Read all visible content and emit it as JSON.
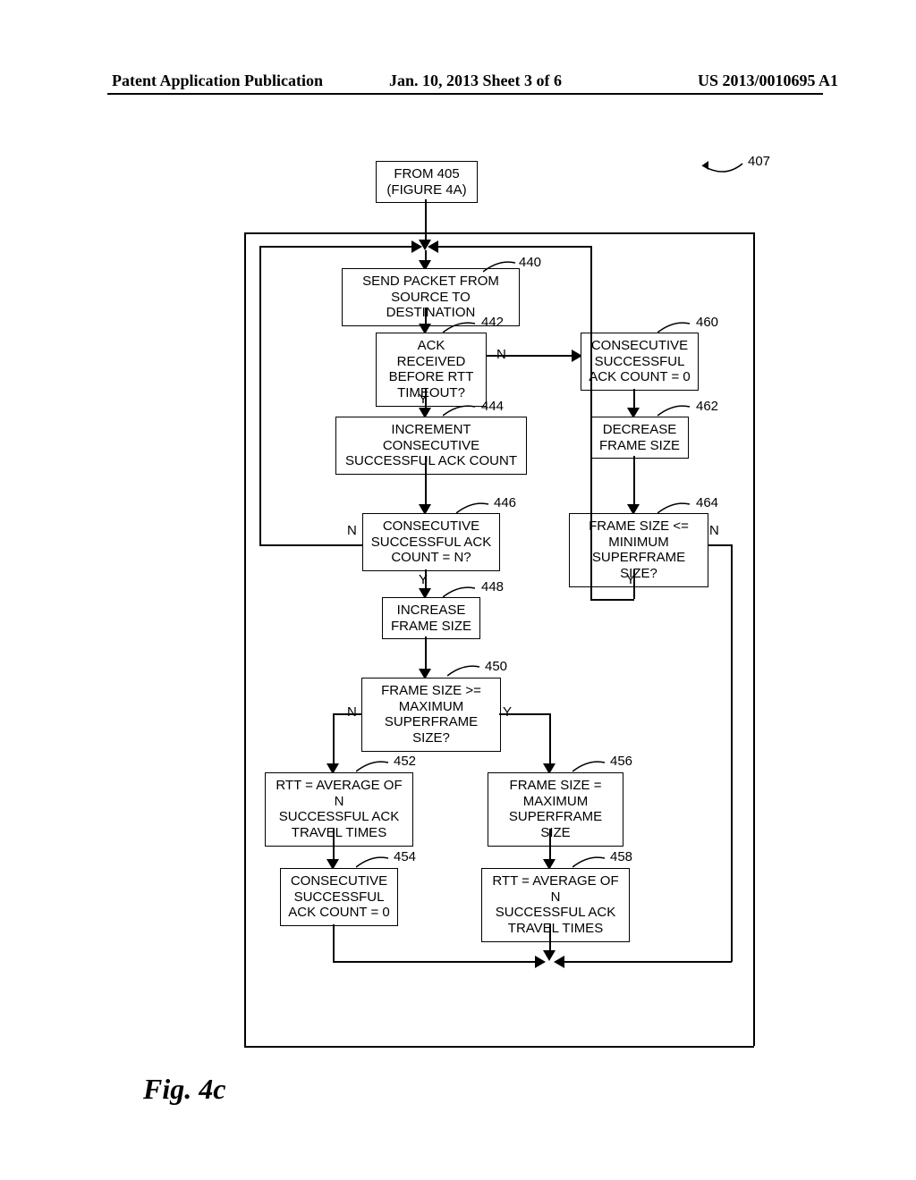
{
  "header": {
    "left": "Patent Application Publication",
    "center": "Jan. 10, 2013  Sheet 3 of 6",
    "right": "US 2013/0010695 A1"
  },
  "topbox": {
    "line1": "FROM 405",
    "line2": "(FIGURE 4A)"
  },
  "ref407": "407",
  "b440": {
    "line1": "SEND PACKET FROM",
    "line2": "SOURCE TO DESTINATION",
    "ref": "440"
  },
  "b442": {
    "line1": "ACK RECEIVED",
    "line2": "BEFORE RTT",
    "line3": "TIMEOUT?",
    "ref": "442",
    "yes": "Y",
    "no": "N"
  },
  "b444": {
    "line1": "INCREMENT CONSECUTIVE",
    "line2": "SUCCESSFUL ACK COUNT",
    "ref": "444"
  },
  "b446": {
    "line1": "CONSECUTIVE",
    "line2": "SUCCESSFUL ACK",
    "line3": "COUNT = N?",
    "ref": "446",
    "yes": "Y",
    "no": "N"
  },
  "b448": {
    "line1": "INCREASE",
    "line2": "FRAME SIZE",
    "ref": "448"
  },
  "b450": {
    "line1": "FRAME SIZE >=",
    "line2": "MAXIMUM",
    "line3": "SUPERFRAME SIZE?",
    "ref": "450",
    "yes": "Y",
    "no": "N"
  },
  "b452": {
    "line1": "RTT = AVERAGE OF N",
    "line2": "SUCCESSFUL ACK",
    "line3": "TRAVEL TIMES",
    "ref": "452"
  },
  "b454": {
    "line1": "CONSECUTIVE",
    "line2": "SUCCESSFUL",
    "line3": "ACK COUNT = 0",
    "ref": "454"
  },
  "b456": {
    "line1": "FRAME SIZE =",
    "line2": "MAXIMUM",
    "line3": "SUPERFRAME SIZE",
    "ref": "456"
  },
  "b458": {
    "line1": "RTT = AVERAGE OF N",
    "line2": "SUCCESSFUL ACK",
    "line3": "TRAVEL TIMES",
    "ref": "458"
  },
  "b460": {
    "line1": "CONSECUTIVE",
    "line2": "SUCCESSFUL",
    "line3": "ACK COUNT = 0",
    "ref": "460"
  },
  "b462": {
    "line1": "DECREASE",
    "line2": "FRAME SIZE",
    "ref": "462"
  },
  "b464": {
    "line1": "FRAME SIZE <=",
    "line2": "MINIMUM",
    "line3": "SUPERFRAME SIZE?",
    "ref": "464",
    "yes": "Y",
    "no": "N"
  },
  "figcap": "Fig. 4c"
}
